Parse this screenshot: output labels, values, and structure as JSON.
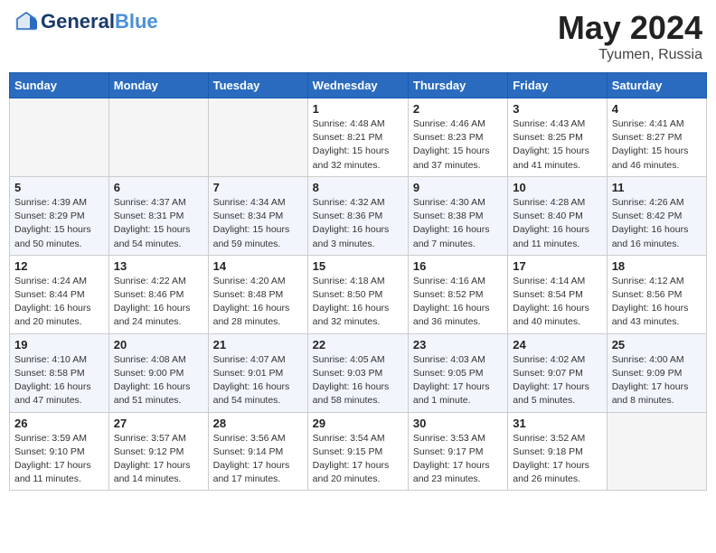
{
  "header": {
    "logo_line1": "General",
    "logo_line2": "Blue",
    "month_year": "May 2024",
    "location": "Tyumen, Russia"
  },
  "weekdays": [
    "Sunday",
    "Monday",
    "Tuesday",
    "Wednesday",
    "Thursday",
    "Friday",
    "Saturday"
  ],
  "weeks": [
    [
      {
        "day": "",
        "info": ""
      },
      {
        "day": "",
        "info": ""
      },
      {
        "day": "",
        "info": ""
      },
      {
        "day": "1",
        "info": "Sunrise: 4:48 AM\nSunset: 8:21 PM\nDaylight: 15 hours\nand 32 minutes."
      },
      {
        "day": "2",
        "info": "Sunrise: 4:46 AM\nSunset: 8:23 PM\nDaylight: 15 hours\nand 37 minutes."
      },
      {
        "day": "3",
        "info": "Sunrise: 4:43 AM\nSunset: 8:25 PM\nDaylight: 15 hours\nand 41 minutes."
      },
      {
        "day": "4",
        "info": "Sunrise: 4:41 AM\nSunset: 8:27 PM\nDaylight: 15 hours\nand 46 minutes."
      }
    ],
    [
      {
        "day": "5",
        "info": "Sunrise: 4:39 AM\nSunset: 8:29 PM\nDaylight: 15 hours\nand 50 minutes."
      },
      {
        "day": "6",
        "info": "Sunrise: 4:37 AM\nSunset: 8:31 PM\nDaylight: 15 hours\nand 54 minutes."
      },
      {
        "day": "7",
        "info": "Sunrise: 4:34 AM\nSunset: 8:34 PM\nDaylight: 15 hours\nand 59 minutes."
      },
      {
        "day": "8",
        "info": "Sunrise: 4:32 AM\nSunset: 8:36 PM\nDaylight: 16 hours\nand 3 minutes."
      },
      {
        "day": "9",
        "info": "Sunrise: 4:30 AM\nSunset: 8:38 PM\nDaylight: 16 hours\nand 7 minutes."
      },
      {
        "day": "10",
        "info": "Sunrise: 4:28 AM\nSunset: 8:40 PM\nDaylight: 16 hours\nand 11 minutes."
      },
      {
        "day": "11",
        "info": "Sunrise: 4:26 AM\nSunset: 8:42 PM\nDaylight: 16 hours\nand 16 minutes."
      }
    ],
    [
      {
        "day": "12",
        "info": "Sunrise: 4:24 AM\nSunset: 8:44 PM\nDaylight: 16 hours\nand 20 minutes."
      },
      {
        "day": "13",
        "info": "Sunrise: 4:22 AM\nSunset: 8:46 PM\nDaylight: 16 hours\nand 24 minutes."
      },
      {
        "day": "14",
        "info": "Sunrise: 4:20 AM\nSunset: 8:48 PM\nDaylight: 16 hours\nand 28 minutes."
      },
      {
        "day": "15",
        "info": "Sunrise: 4:18 AM\nSunset: 8:50 PM\nDaylight: 16 hours\nand 32 minutes."
      },
      {
        "day": "16",
        "info": "Sunrise: 4:16 AM\nSunset: 8:52 PM\nDaylight: 16 hours\nand 36 minutes."
      },
      {
        "day": "17",
        "info": "Sunrise: 4:14 AM\nSunset: 8:54 PM\nDaylight: 16 hours\nand 40 minutes."
      },
      {
        "day": "18",
        "info": "Sunrise: 4:12 AM\nSunset: 8:56 PM\nDaylight: 16 hours\nand 43 minutes."
      }
    ],
    [
      {
        "day": "19",
        "info": "Sunrise: 4:10 AM\nSunset: 8:58 PM\nDaylight: 16 hours\nand 47 minutes."
      },
      {
        "day": "20",
        "info": "Sunrise: 4:08 AM\nSunset: 9:00 PM\nDaylight: 16 hours\nand 51 minutes."
      },
      {
        "day": "21",
        "info": "Sunrise: 4:07 AM\nSunset: 9:01 PM\nDaylight: 16 hours\nand 54 minutes."
      },
      {
        "day": "22",
        "info": "Sunrise: 4:05 AM\nSunset: 9:03 PM\nDaylight: 16 hours\nand 58 minutes."
      },
      {
        "day": "23",
        "info": "Sunrise: 4:03 AM\nSunset: 9:05 PM\nDaylight: 17 hours\nand 1 minute."
      },
      {
        "day": "24",
        "info": "Sunrise: 4:02 AM\nSunset: 9:07 PM\nDaylight: 17 hours\nand 5 minutes."
      },
      {
        "day": "25",
        "info": "Sunrise: 4:00 AM\nSunset: 9:09 PM\nDaylight: 17 hours\nand 8 minutes."
      }
    ],
    [
      {
        "day": "26",
        "info": "Sunrise: 3:59 AM\nSunset: 9:10 PM\nDaylight: 17 hours\nand 11 minutes."
      },
      {
        "day": "27",
        "info": "Sunrise: 3:57 AM\nSunset: 9:12 PM\nDaylight: 17 hours\nand 14 minutes."
      },
      {
        "day": "28",
        "info": "Sunrise: 3:56 AM\nSunset: 9:14 PM\nDaylight: 17 hours\nand 17 minutes."
      },
      {
        "day": "29",
        "info": "Sunrise: 3:54 AM\nSunset: 9:15 PM\nDaylight: 17 hours\nand 20 minutes."
      },
      {
        "day": "30",
        "info": "Sunrise: 3:53 AM\nSunset: 9:17 PM\nDaylight: 17 hours\nand 23 minutes."
      },
      {
        "day": "31",
        "info": "Sunrise: 3:52 AM\nSunset: 9:18 PM\nDaylight: 17 hours\nand 26 minutes."
      },
      {
        "day": "",
        "info": ""
      }
    ]
  ]
}
